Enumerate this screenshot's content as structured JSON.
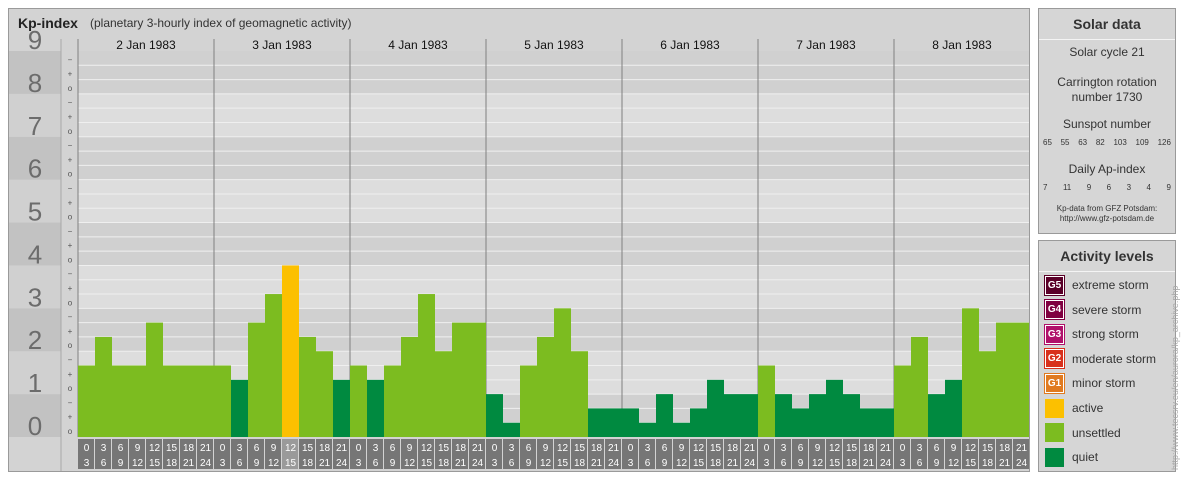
{
  "header": {
    "title": "Kp-index",
    "subtitle": "(planetary 3-hourly index of geomagnetic activity)"
  },
  "chart_data": {
    "type": "bar",
    "title": "Kp-index",
    "subtitle": "(planetary 3-hourly index of geomagnetic activity)",
    "ylim": [
      0,
      9
    ],
    "yticks": [
      "0",
      "1",
      "2",
      "3",
      "4",
      "5",
      "6",
      "7",
      "8",
      "9"
    ],
    "minor_ticks": [
      "o",
      "+",
      "−"
    ],
    "days": [
      "2 Jan 1983",
      "3 Jan 1983",
      "4 Jan 1983",
      "5 Jan 1983",
      "6 Jan 1983",
      "7 Jan 1983",
      "8 Jan 1983"
    ],
    "interval_labels": [
      [
        "0",
        "3"
      ],
      [
        "3",
        "6"
      ],
      [
        "6",
        "9"
      ],
      [
        "9",
        "12"
      ],
      [
        "12",
        "15"
      ],
      [
        "15",
        "18"
      ],
      [
        "18",
        "21"
      ],
      [
        "21",
        "24"
      ]
    ],
    "values": [
      [
        1.667,
        2.333,
        1.667,
        1.667,
        2.667,
        1.667,
        1.667,
        1.667
      ],
      [
        1.667,
        1.333,
        2.667,
        3.333,
        4.0,
        2.333,
        2.0,
        1.333
      ],
      [
        1.667,
        1.333,
        1.667,
        2.333,
        3.333,
        2.0,
        2.667,
        2.667
      ],
      [
        1.0,
        0.333,
        1.667,
        2.333,
        3.0,
        2.0,
        0.667,
        0.667
      ],
      [
        0.667,
        0.333,
        1.0,
        0.333,
        0.667,
        1.333,
        1.0,
        1.0
      ],
      [
        1.667,
        1.0,
        0.667,
        1.0,
        1.333,
        1.0,
        0.667,
        0.667
      ],
      [
        1.667,
        2.333,
        1.0,
        1.333,
        3.0,
        2.0,
        2.667,
        2.667
      ]
    ],
    "highlight_interval": [
      1,
      4
    ],
    "colors": {
      "quiet": "#008a40",
      "unsettled": "#7cbc20",
      "active": "#fcc000",
      "minor_storm": "#e07a20",
      "moderate_storm": "#d8301c",
      "strong_storm": "#b0106a",
      "severe_storm": "#800040",
      "extreme_storm": "#5a0028"
    }
  },
  "solar": {
    "title": "Solar data",
    "cycle": "Solar cycle 21",
    "carrington_line1": "Carrington rotation",
    "carrington_line2": "number 1730",
    "sunspot_title": "Sunspot number",
    "sunspot_values": [
      "65",
      "55",
      "63",
      "82",
      "103",
      "109",
      "126"
    ],
    "ap_title": "Daily Ap-index",
    "ap_values": [
      "7",
      "11",
      "9",
      "6",
      "3",
      "4",
      "9"
    ],
    "source_line1": "Kp-data from GFZ Potsdam:",
    "source_line2": "http://www.gfz-potsdam.de"
  },
  "levels": {
    "title": "Activity levels",
    "items": [
      {
        "badge": "G5",
        "label": "extreme storm",
        "color": "#5a0028"
      },
      {
        "badge": "G4",
        "label": "severe storm",
        "color": "#800040"
      },
      {
        "badge": "G3",
        "label": "strong storm",
        "color": "#b0106a"
      },
      {
        "badge": "G2",
        "label": "moderate storm",
        "color": "#d8301c"
      },
      {
        "badge": "G1",
        "label": "minor storm",
        "color": "#e07a20"
      },
      {
        "badge": "",
        "label": "active",
        "color": "#fcc000"
      },
      {
        "badge": "",
        "label": "unsettled",
        "color": "#7cbc20"
      },
      {
        "badge": "",
        "label": "quiet",
        "color": "#008a40"
      }
    ]
  },
  "credit": "http://www.tecsrv.eu/en/aurora/kp_archive.php"
}
